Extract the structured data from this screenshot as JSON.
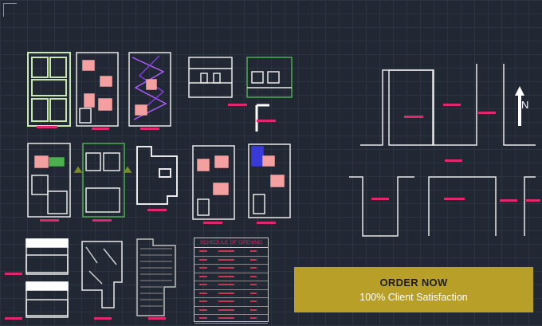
{
  "app": {
    "title": "CAD floor plan drawings"
  },
  "banner": {
    "cta": "ORDER NOW",
    "subtitle": "100% Client Satisfaction"
  },
  "schedule": {
    "title": "SCHEDULE OF OPENING",
    "rows": 9
  },
  "north_arrow": {
    "label": "N"
  },
  "colors": {
    "background": "#212733",
    "grid": "#2b3240",
    "walls": "#e8e8e8",
    "furniture": "#f4a0a0",
    "tags": "#e0286c",
    "green": "#4caf50",
    "banner": "#b8a028"
  }
}
